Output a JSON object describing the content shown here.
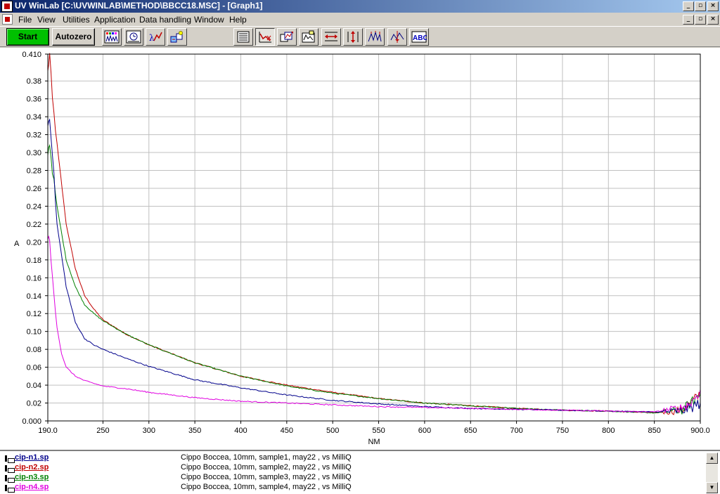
{
  "window": {
    "title": "UV WinLab [C:\\UVWINLAB\\METHOD\\BBCC18.MSC] - [Graph1]",
    "app_icon": "app-icon",
    "caption_buttons": [
      "_",
      "▫",
      "×"
    ],
    "mdi_buttons": [
      "_",
      "▫",
      "×"
    ]
  },
  "menu": {
    "items": [
      "File",
      "View",
      "Utilities",
      "Application",
      "Data handling",
      "Window",
      "Help"
    ]
  },
  "toolbar": {
    "start_label": "Start",
    "autozero_label": "Autozero",
    "abc_label": "ABC",
    "start_color": "#00c000"
  },
  "chart_data": {
    "type": "line",
    "xlabel": "NM",
    "ylabel": "A",
    "xlim": [
      190,
      900
    ],
    "ylim": [
      0.0,
      0.41
    ],
    "x_ticks": [
      190,
      250,
      300,
      350,
      400,
      450,
      500,
      550,
      600,
      650,
      700,
      750,
      800,
      850,
      900
    ],
    "x_tick_labels": [
      "190.0",
      "250",
      "300",
      "350",
      "400",
      "450",
      "500",
      "550",
      "600",
      "650",
      "700",
      "750",
      "800",
      "850",
      "900.0"
    ],
    "y_ticks": [
      0.0,
      0.02,
      0.04,
      0.06,
      0.08,
      0.1,
      0.12,
      0.14,
      0.16,
      0.18,
      0.2,
      0.22,
      0.24,
      0.26,
      0.28,
      0.3,
      0.32,
      0.34,
      0.36,
      0.38,
      0.41
    ],
    "y_tick_labels": [
      "0.000",
      "0.02",
      "0.04",
      "0.06",
      "0.08",
      "0.10",
      "0.12",
      "0.14",
      "0.16",
      "0.18",
      "0.20",
      "0.22",
      "0.24",
      "0.26",
      "0.28",
      "0.30",
      "0.32",
      "0.34",
      "0.36",
      "0.38",
      "0.410"
    ],
    "grid": true,
    "series": [
      {
        "color": "#c00000",
        "x": [
          190,
          192,
          195,
          200,
          210,
          220,
          230,
          240,
          250,
          275,
          300,
          350,
          400,
          450,
          500,
          550,
          600,
          650,
          700,
          750,
          800,
          850,
          880,
          890,
          900
        ],
        "y": [
          0.39,
          0.41,
          0.36,
          0.31,
          0.22,
          0.17,
          0.14,
          0.125,
          0.113,
          0.097,
          0.085,
          0.065,
          0.05,
          0.04,
          0.032,
          0.025,
          0.02,
          0.017,
          0.014,
          0.012,
          0.011,
          0.009,
          0.012,
          0.02,
          0.03
        ]
      },
      {
        "color": "#008000",
        "x": [
          190,
          192,
          195,
          200,
          210,
          220,
          230,
          240,
          250,
          275,
          300,
          350,
          400,
          450,
          500,
          550,
          600,
          650,
          700,
          750,
          800,
          850,
          880,
          890,
          900
        ],
        "y": [
          0.3,
          0.31,
          0.28,
          0.24,
          0.18,
          0.15,
          0.13,
          0.12,
          0.112,
          0.097,
          0.085,
          0.065,
          0.05,
          0.039,
          0.031,
          0.025,
          0.02,
          0.017,
          0.014,
          0.012,
          0.011,
          0.009,
          0.012,
          0.02,
          0.03
        ]
      },
      {
        "color": "#00008b",
        "x": [
          190,
          192,
          195,
          200,
          210,
          220,
          230,
          240,
          250,
          275,
          300,
          350,
          400,
          450,
          500,
          550,
          600,
          650,
          700,
          750,
          800,
          850,
          880,
          890,
          900
        ],
        "y": [
          0.33,
          0.34,
          0.3,
          0.22,
          0.15,
          0.11,
          0.092,
          0.085,
          0.08,
          0.07,
          0.061,
          0.046,
          0.037,
          0.029,
          0.023,
          0.019,
          0.016,
          0.014,
          0.013,
          0.012,
          0.011,
          0.01,
          0.011,
          0.015,
          0.02
        ]
      },
      {
        "color": "#e000e0",
        "x": [
          190,
          192,
          195,
          200,
          205,
          210,
          220,
          230,
          250,
          275,
          300,
          350,
          400,
          450,
          500,
          550,
          600,
          650,
          700,
          750,
          800,
          850,
          880,
          890,
          900
        ],
        "y": [
          0.205,
          0.2,
          0.16,
          0.105,
          0.075,
          0.06,
          0.05,
          0.045,
          0.039,
          0.036,
          0.032,
          0.026,
          0.022,
          0.02,
          0.018,
          0.016,
          0.015,
          0.014,
          0.013,
          0.012,
          0.011,
          0.01,
          0.015,
          0.02,
          0.035
        ]
      }
    ]
  },
  "spectra": [
    {
      "file": "cip-n1.sp",
      "desc": "Cippo Boccea, 10mm, sample1, may22 , vs MilliQ",
      "color": "#00008b"
    },
    {
      "file": "cip-n2.sp",
      "desc": "Cippo Boccea, 10mm, sample2, may22 , vs MilliQ",
      "color": "#c00000"
    },
    {
      "file": "cip-n3.sp",
      "desc": "Cippo Boccea, 10mm, sample3, may22 , vs MilliQ",
      "color": "#008000"
    },
    {
      "file": "cip-n4.sp",
      "desc": "Cippo Boccea, 10mm, sample4, may22 , vs MilliQ",
      "color": "#e000e0"
    }
  ],
  "scroll": {
    "up": "▲",
    "down": "▼"
  }
}
